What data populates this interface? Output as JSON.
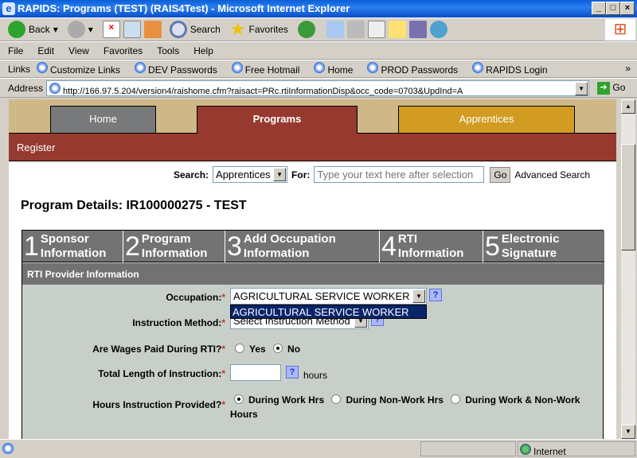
{
  "window": {
    "title": "RAPIDS: Programs  (TEST) (RAIS4Test) - Microsoft Internet Explorer",
    "min": "_",
    "max": "□",
    "close": "×"
  },
  "toolbar": {
    "back": "Back",
    "search": "Search",
    "favorites": "Favorites"
  },
  "menu": [
    "File",
    "Edit",
    "View",
    "Favorites",
    "Tools",
    "Help"
  ],
  "links": {
    "label": "Links",
    "items": [
      "Customize Links",
      "DEV Passwords",
      "Free Hotmail",
      "Home",
      "PROD Passwords",
      "RAPIDS Login"
    ],
    "more": "»"
  },
  "address": {
    "label": "Address",
    "url": "http://166.97.5.204/version4/raishome.cfm?raisact=PRc.rtiInformationDisp&occ_code=0703&UpdInd=A",
    "go": "Go"
  },
  "nav": {
    "tabs": [
      "Home",
      "Programs",
      "Apprentices"
    ],
    "active": "Programs",
    "sub": "Register"
  },
  "search": {
    "label": "Search:",
    "scope": "Apprentices",
    "for_label": "For:",
    "placeholder": "Type your text here after selection",
    "go": "Go",
    "advanced": "Advanced Search"
  },
  "page_title": "Program Details: IR100000275 - TEST",
  "steps": [
    {
      "n": "1",
      "l1": "Sponsor",
      "l2": "Information"
    },
    {
      "n": "2",
      "l1": "Program",
      "l2": "Information"
    },
    {
      "n": "3",
      "l1": "Add Occupation",
      "l2": "Information"
    },
    {
      "n": "4",
      "l1": "RTI",
      "l2": "Information"
    },
    {
      "n": "5",
      "l1": "Electronic",
      "l2": "Signature"
    }
  ],
  "section": "RTI Provider Information",
  "form": {
    "occupation": {
      "label": "Occupation:",
      "value": "AGRICULTURAL SERVICE WORKER",
      "dropdown_option": "AGRICULTURAL SERVICE WORKER"
    },
    "method": {
      "label": "Instruction Method:",
      "value": "Select Instruction Method"
    },
    "wages": {
      "label": "Are Wages Paid During RTI?",
      "options": [
        "Yes",
        "No"
      ],
      "selected": "No"
    },
    "length": {
      "label": "Total Length of Instruction:",
      "value": "",
      "unit": "hours"
    },
    "hours": {
      "label": "Hours Instruction Provided?",
      "options": [
        "During Work Hrs",
        "During Non-Work Hrs",
        "During Work & Non-Work Hours"
      ],
      "selected": "During Work Hrs"
    },
    "required": "*",
    "help": "?"
  },
  "status": {
    "zone": "Internet"
  },
  "colors": {
    "home_tab": "#78797b",
    "programs_tab": "#963a2f",
    "apprentices_tab": "#d29c22",
    "tan": "#cfb888",
    "step_bar": "#737373",
    "form_bg": "#c8cfc8"
  }
}
